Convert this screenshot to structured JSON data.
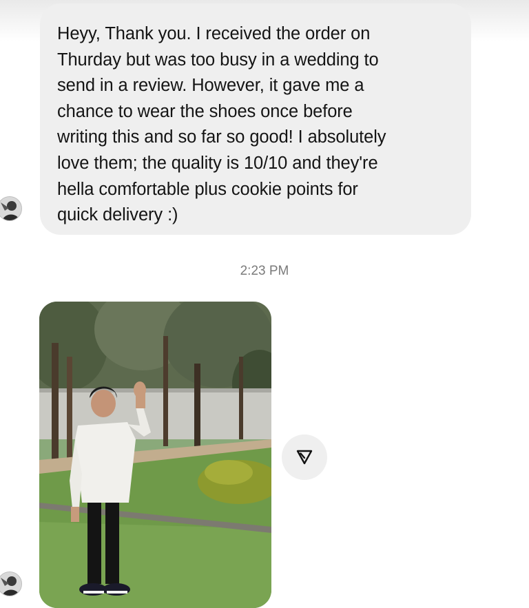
{
  "conversation": {
    "message": {
      "text": "Heyy, Thank you. I received the order on Thurday but was too busy in a wedding to send in a review. However, it gave me a chance to wear the shoes once before writing this and so far so good! I absolutely love them; the quality is 10/10 and they're hella comfortable plus cookie points for quick delivery :)",
      "lines": [
        "Heyy, Thank you. I received the order on",
        "Thurday but was too busy in a wedding to",
        "send in a review. However, it gave me a",
        "chance to wear the shoes once before",
        "writing this and so far so good! I absolutely",
        "love them; the quality is 10/10 and they're",
        "hella comfortable plus cookie points for",
        "quick delivery :)"
      ]
    },
    "timestamp": "2:23 PM",
    "photo": {
      "icon": "photo-message"
    },
    "share_button": {
      "icon": "share-icon"
    }
  },
  "colors": {
    "bubble_bg": "#efefef",
    "text": "#141414",
    "timestamp": "#7a7a7a",
    "background": "#ffffff"
  }
}
